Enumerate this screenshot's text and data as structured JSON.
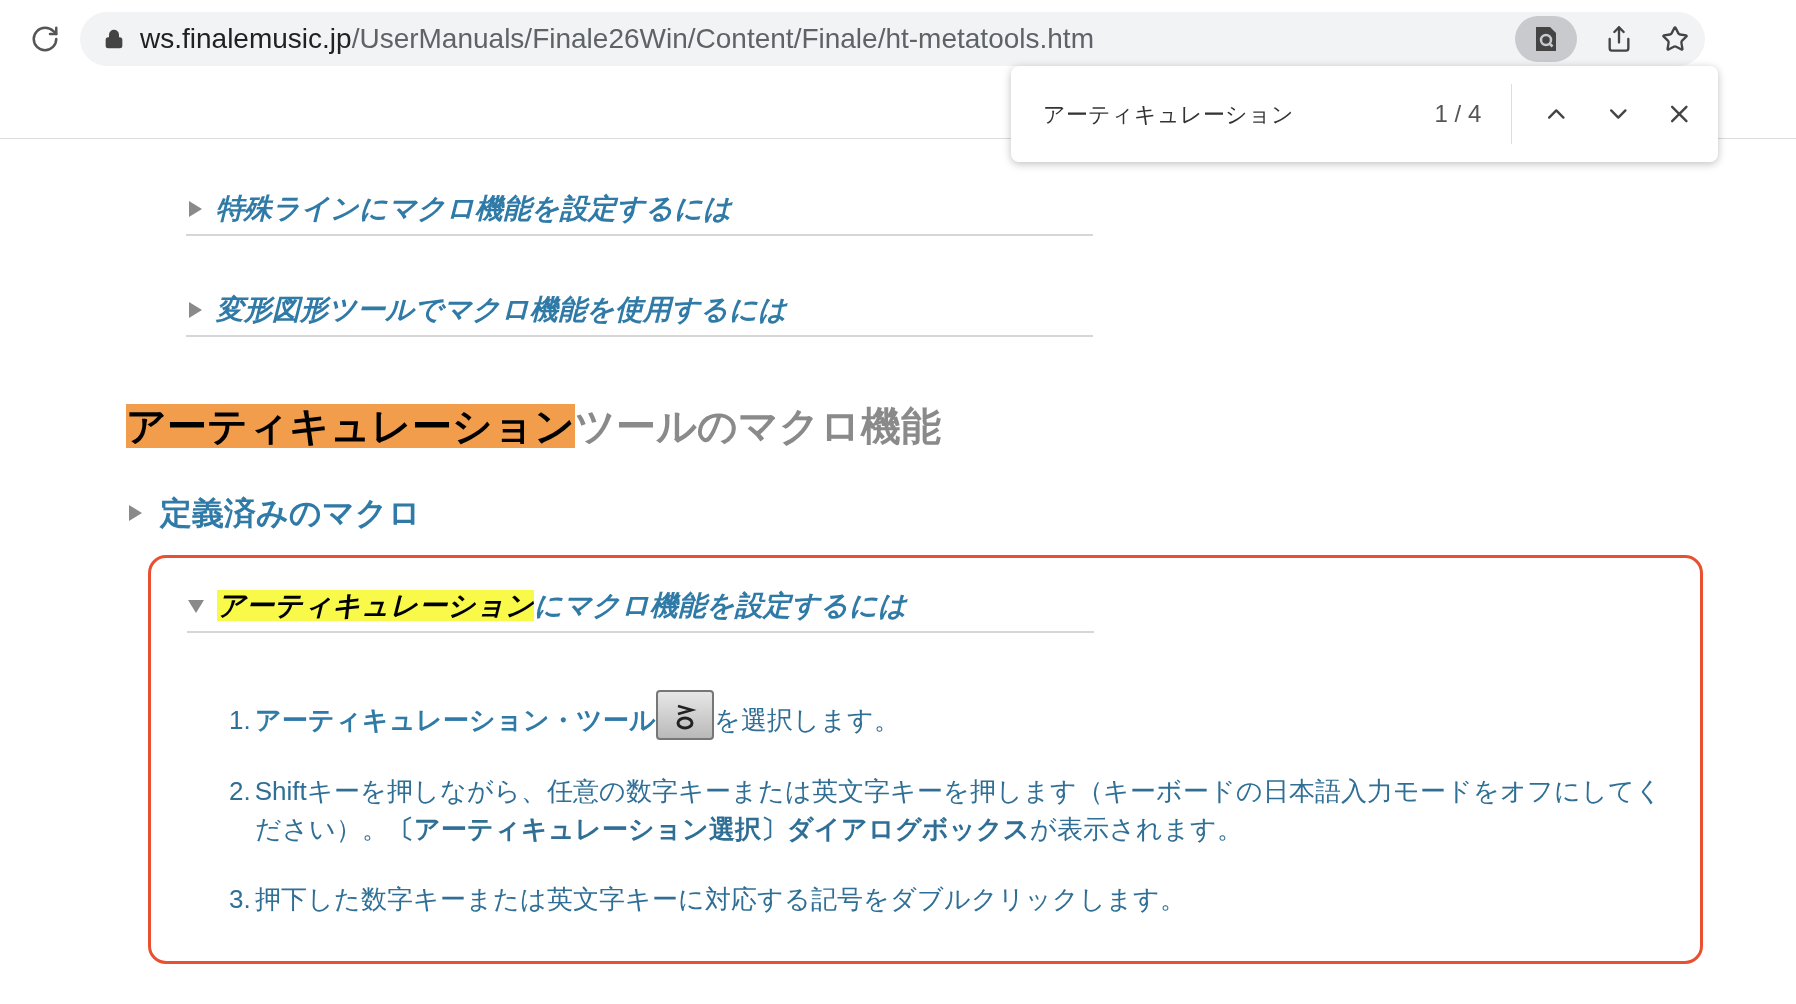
{
  "browser": {
    "url_host": "ws.finalemusic.jp",
    "url_path": "/UserManuals/Finale26Win/Content/Finale/ht-metatools.htm"
  },
  "find_bar": {
    "query": "アーティキュレーション",
    "count": "1 / 4"
  },
  "sections": [
    {
      "kind": "sub",
      "expanded": false,
      "parts": [
        {
          "text": "特殊ラインにマクロ機能を設定するには",
          "match": false,
          "current": false
        }
      ]
    },
    {
      "kind": "sub",
      "expanded": false,
      "parts": [
        {
          "text": "変形図形ツールでマクロ機能を使用するには",
          "match": false,
          "current": false
        }
      ]
    },
    {
      "kind": "heading",
      "parts": [
        {
          "text": "アーティキュレーション",
          "match": true,
          "current": true
        },
        {
          "text": "ツールのマクロ機能",
          "match": false,
          "current": false
        }
      ]
    },
    {
      "kind": "toggle",
      "expanded": false,
      "parts": [
        {
          "text": "定義済みのマクロ",
          "match": false,
          "current": false
        }
      ]
    },
    {
      "kind": "sub",
      "expanded": true,
      "boxed": true,
      "parts": [
        {
          "text": "アーティキュレーション",
          "match": true,
          "current": false
        },
        {
          "text": "にマクロ機能を設定するには",
          "match": false,
          "current": false
        }
      ],
      "steps": [
        {
          "number": "1.",
          "link": "アーティキュレーション・ツール",
          "tool_icon": true,
          "text": "を選択します。"
        },
        {
          "number": "2.",
          "text": "Shiftキーを押しながら、任意の数字キーまたは英文字キーを押します（キーボードの日本語入力モードをオフにしてください）。**〔アーティキュレーション選択〕ダイアログボックス**が表示されます。"
        },
        {
          "number": "3.",
          "text": "押下した数字キーまたは英文字キーに対応する記号をダブルクリックします。"
        }
      ]
    }
  ]
}
